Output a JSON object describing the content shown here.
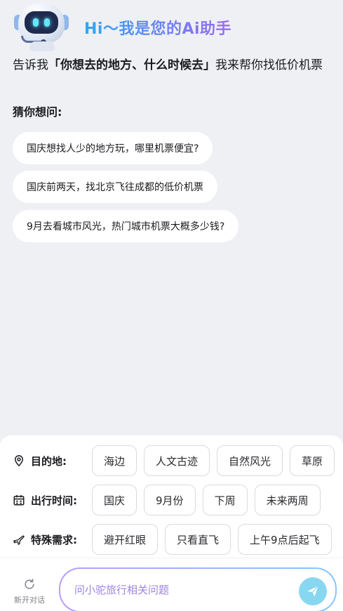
{
  "header": {
    "title": "Hi～我是您的Ai助手"
  },
  "intro": {
    "prefix": "告诉我",
    "highlight": "「你想去的地方、什么时候去」",
    "suffix": "我来帮你找低价机票"
  },
  "suggestions": {
    "label": "猜你想问:",
    "items": [
      "国庆想找人少的地方玩，哪里机票便宜?",
      "国庆前两天，找北京飞往成都的低价机票",
      "9月去看城市风光，热门城市机票大概多少钱?"
    ]
  },
  "filters": {
    "destination": {
      "label": "目的地:",
      "icon": "location-pin-icon",
      "chips": [
        "海边",
        "人文古迹",
        "自然风光",
        "草原"
      ]
    },
    "time": {
      "label": "出行时间:",
      "icon": "calendar-icon",
      "chips": [
        "国庆",
        "9月份",
        "下周",
        "未来两周"
      ]
    },
    "needs": {
      "label": "特殊需求:",
      "icon": "airplane-icon",
      "chips": [
        "避开红眼",
        "只看直飞",
        "上午9点后起飞"
      ]
    }
  },
  "bottom": {
    "new_chat_label": "新开对话",
    "input_placeholder": "问小驼旅行相关问题",
    "accent_colors": [
      "#b99cff",
      "#87c6ff"
    ],
    "send_color": "#88d7f0"
  }
}
